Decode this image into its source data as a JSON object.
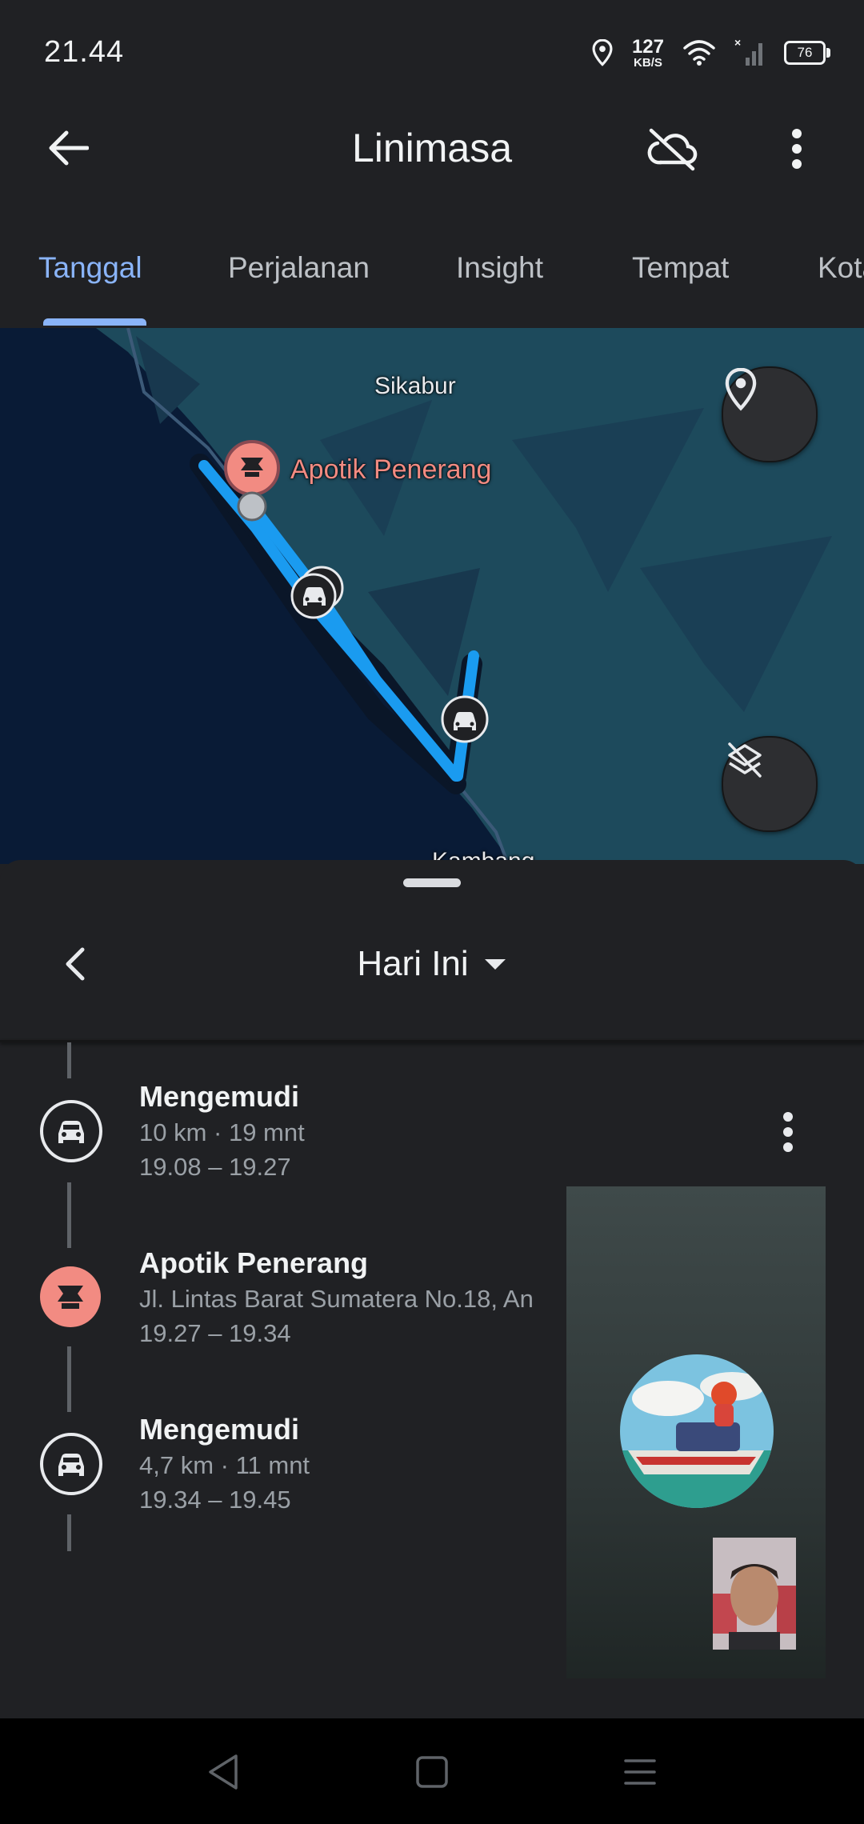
{
  "status_bar": {
    "time": "21.44",
    "net_speed_value": "127",
    "net_speed_unit": "KB/S",
    "battery": "76",
    "icons": [
      "location-icon",
      "wifi-icon",
      "no-signal-icon",
      "battery-icon"
    ]
  },
  "app_bar": {
    "title": "Linimasa",
    "icons": [
      "back-arrow-icon",
      "cloud-off-icon",
      "more-vert-icon"
    ]
  },
  "tabs": [
    {
      "label": "Tanggal",
      "active": true
    },
    {
      "label": "Perjalanan",
      "active": false
    },
    {
      "label": "Insight",
      "active": false
    },
    {
      "label": "Tempat",
      "active": false
    },
    {
      "label": "Kota",
      "active": false
    }
  ],
  "map": {
    "labels": {
      "top": "Sikabur",
      "bottom": "Kambang"
    },
    "poi": "Apotik Penerang",
    "route_color": "#1a9bf0",
    "icons": [
      "pharmacy-pin-icon",
      "car-marker-icon",
      "location-pin-icon",
      "layers-off-icon"
    ]
  },
  "sheet": {
    "date_label": "Hari Ini",
    "icons": [
      "chevron-left-icon",
      "dropdown-arrow-icon"
    ]
  },
  "timeline": [
    {
      "type": "drive",
      "title": "Mengemudi",
      "line1": "10 km · 19 mnt",
      "line2": "19.08 – 19.27",
      "icon": "car-icon"
    },
    {
      "type": "place",
      "title": "Apotik Penerang",
      "line1": "Jl. Lintas Barat Sumatera No.18, An",
      "line2": "19.27 – 19.34",
      "icon": "pharmacy-icon"
    },
    {
      "type": "drive",
      "title": "Mengemudi",
      "line1": "4,7 km · 11 mnt",
      "line2": "19.34 – 19.45",
      "icon": "car-icon"
    }
  ],
  "colors": {
    "background": "#202124",
    "accent": "#8ab4f8",
    "pharmacy": "#f28b82",
    "map_water": "#0b1f3a",
    "map_land": "#1e4a5c"
  }
}
